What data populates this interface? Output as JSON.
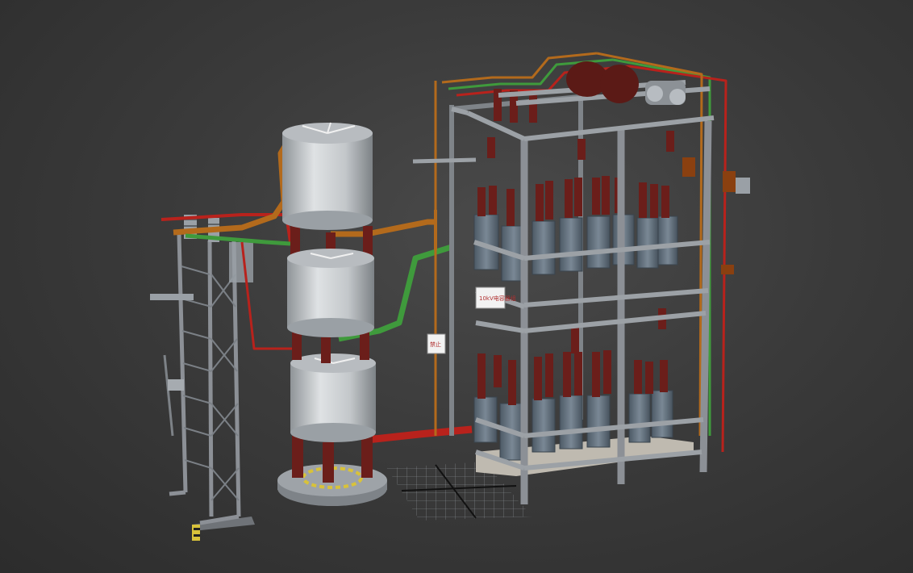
{
  "viewport": {
    "background": "#3a3a3a",
    "objects": [
      {
        "name": "isolating-switch-frame"
      },
      {
        "name": "series-reactor-stack",
        "coils": 3
      },
      {
        "name": "capacitor-bank-frame",
        "tiers": 2
      },
      {
        "name": "ground-grid"
      }
    ],
    "sign_label": "10kV电容器组",
    "small_sign_label": "禁止"
  },
  "colors": {
    "steel": "#8c9096",
    "reactor": "#c9cdd0",
    "insulator": "#6b1e1a",
    "bus_orange": "#b36a1c",
    "bus_green": "#3f9a3c",
    "bus_red": "#b8221c",
    "capacitor": "#5d6b78"
  }
}
